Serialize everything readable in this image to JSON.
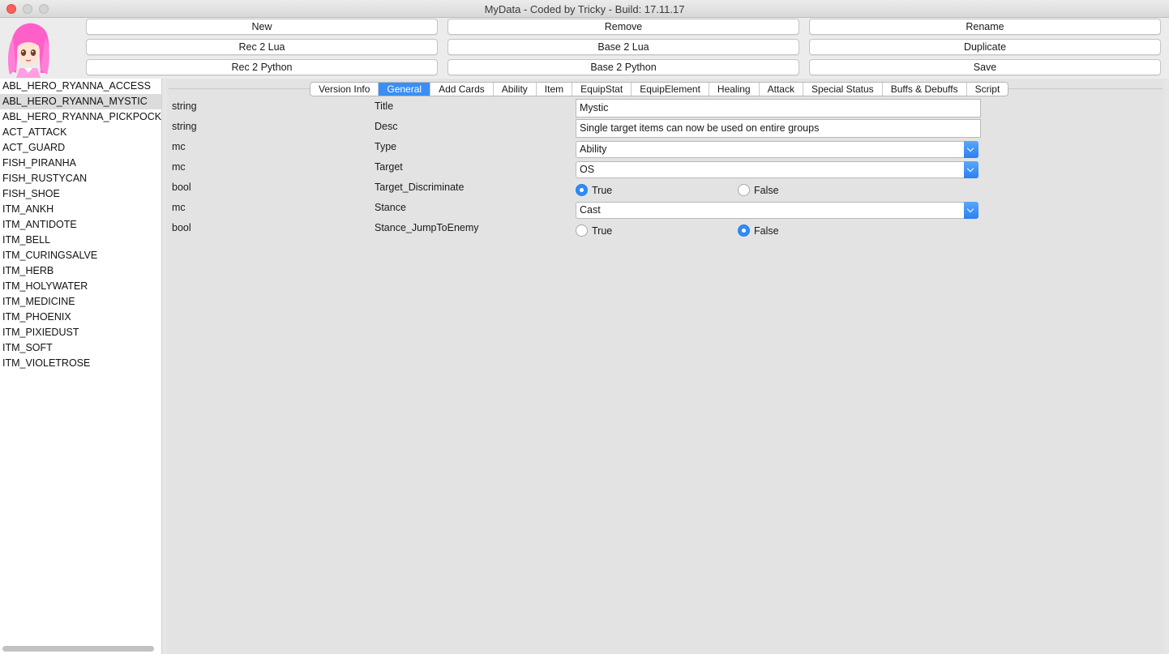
{
  "window": {
    "title": "MyData - Coded by Tricky - Build: 17.11.17"
  },
  "toolbar": {
    "new": "New",
    "remove": "Remove",
    "rename": "Rename",
    "rec2lua": "Rec 2 Lua",
    "base2lua": "Base 2 Lua",
    "duplicate": "Duplicate",
    "rec2python": "Rec 2 Python",
    "base2python": "Base 2 Python",
    "save": "Save"
  },
  "sidebar": {
    "items": [
      "ABL_HERO_RYANNA_ACCESS",
      "ABL_HERO_RYANNA_MYSTIC",
      "ABL_HERO_RYANNA_PICKPOCKET",
      "ACT_ATTACK",
      "ACT_GUARD",
      "FISH_PIRANHA",
      "FISH_RUSTYCAN",
      "FISH_SHOE",
      "ITM_ANKH",
      "ITM_ANTIDOTE",
      "ITM_BELL",
      "ITM_CURINGSALVE",
      "ITM_HERB",
      "ITM_HOLYWATER",
      "ITM_MEDICINE",
      "ITM_PHOENIX",
      "ITM_PIXIEDUST",
      "ITM_SOFT",
      "ITM_VIOLETROSE"
    ],
    "selected_index": 1
  },
  "tabs": [
    "Version Info",
    "General",
    "Add Cards",
    "Ability",
    "Item",
    "EquipStat",
    "EquipElement",
    "Healing",
    "Attack",
    "Special Status",
    "Buffs & Debuffs",
    "Script"
  ],
  "active_tab": "General",
  "fields": {
    "title": {
      "type": "string",
      "name": "Title",
      "value": "Mystic"
    },
    "desc": {
      "type": "string",
      "name": "Desc",
      "value": "Single target items can now be used on entire groups"
    },
    "kind": {
      "type": "mc",
      "name": "Type",
      "value": "Ability"
    },
    "target": {
      "type": "mc",
      "name": "Target",
      "value": "OS"
    },
    "target_discriminate": {
      "type": "bool",
      "name": "Target_Discriminate",
      "true_label": "True",
      "false_label": "False",
      "value": true
    },
    "stance": {
      "type": "mc",
      "name": "Stance",
      "value": "Cast"
    },
    "stance_jump": {
      "type": "bool",
      "name": "Stance_JumpToEnemy",
      "true_label": "True",
      "false_label": "False",
      "value": false
    }
  },
  "colors": {
    "accent": "#3a8ef6",
    "close_button": "#fc605c",
    "avatar_hair": "#ff5fc8"
  }
}
